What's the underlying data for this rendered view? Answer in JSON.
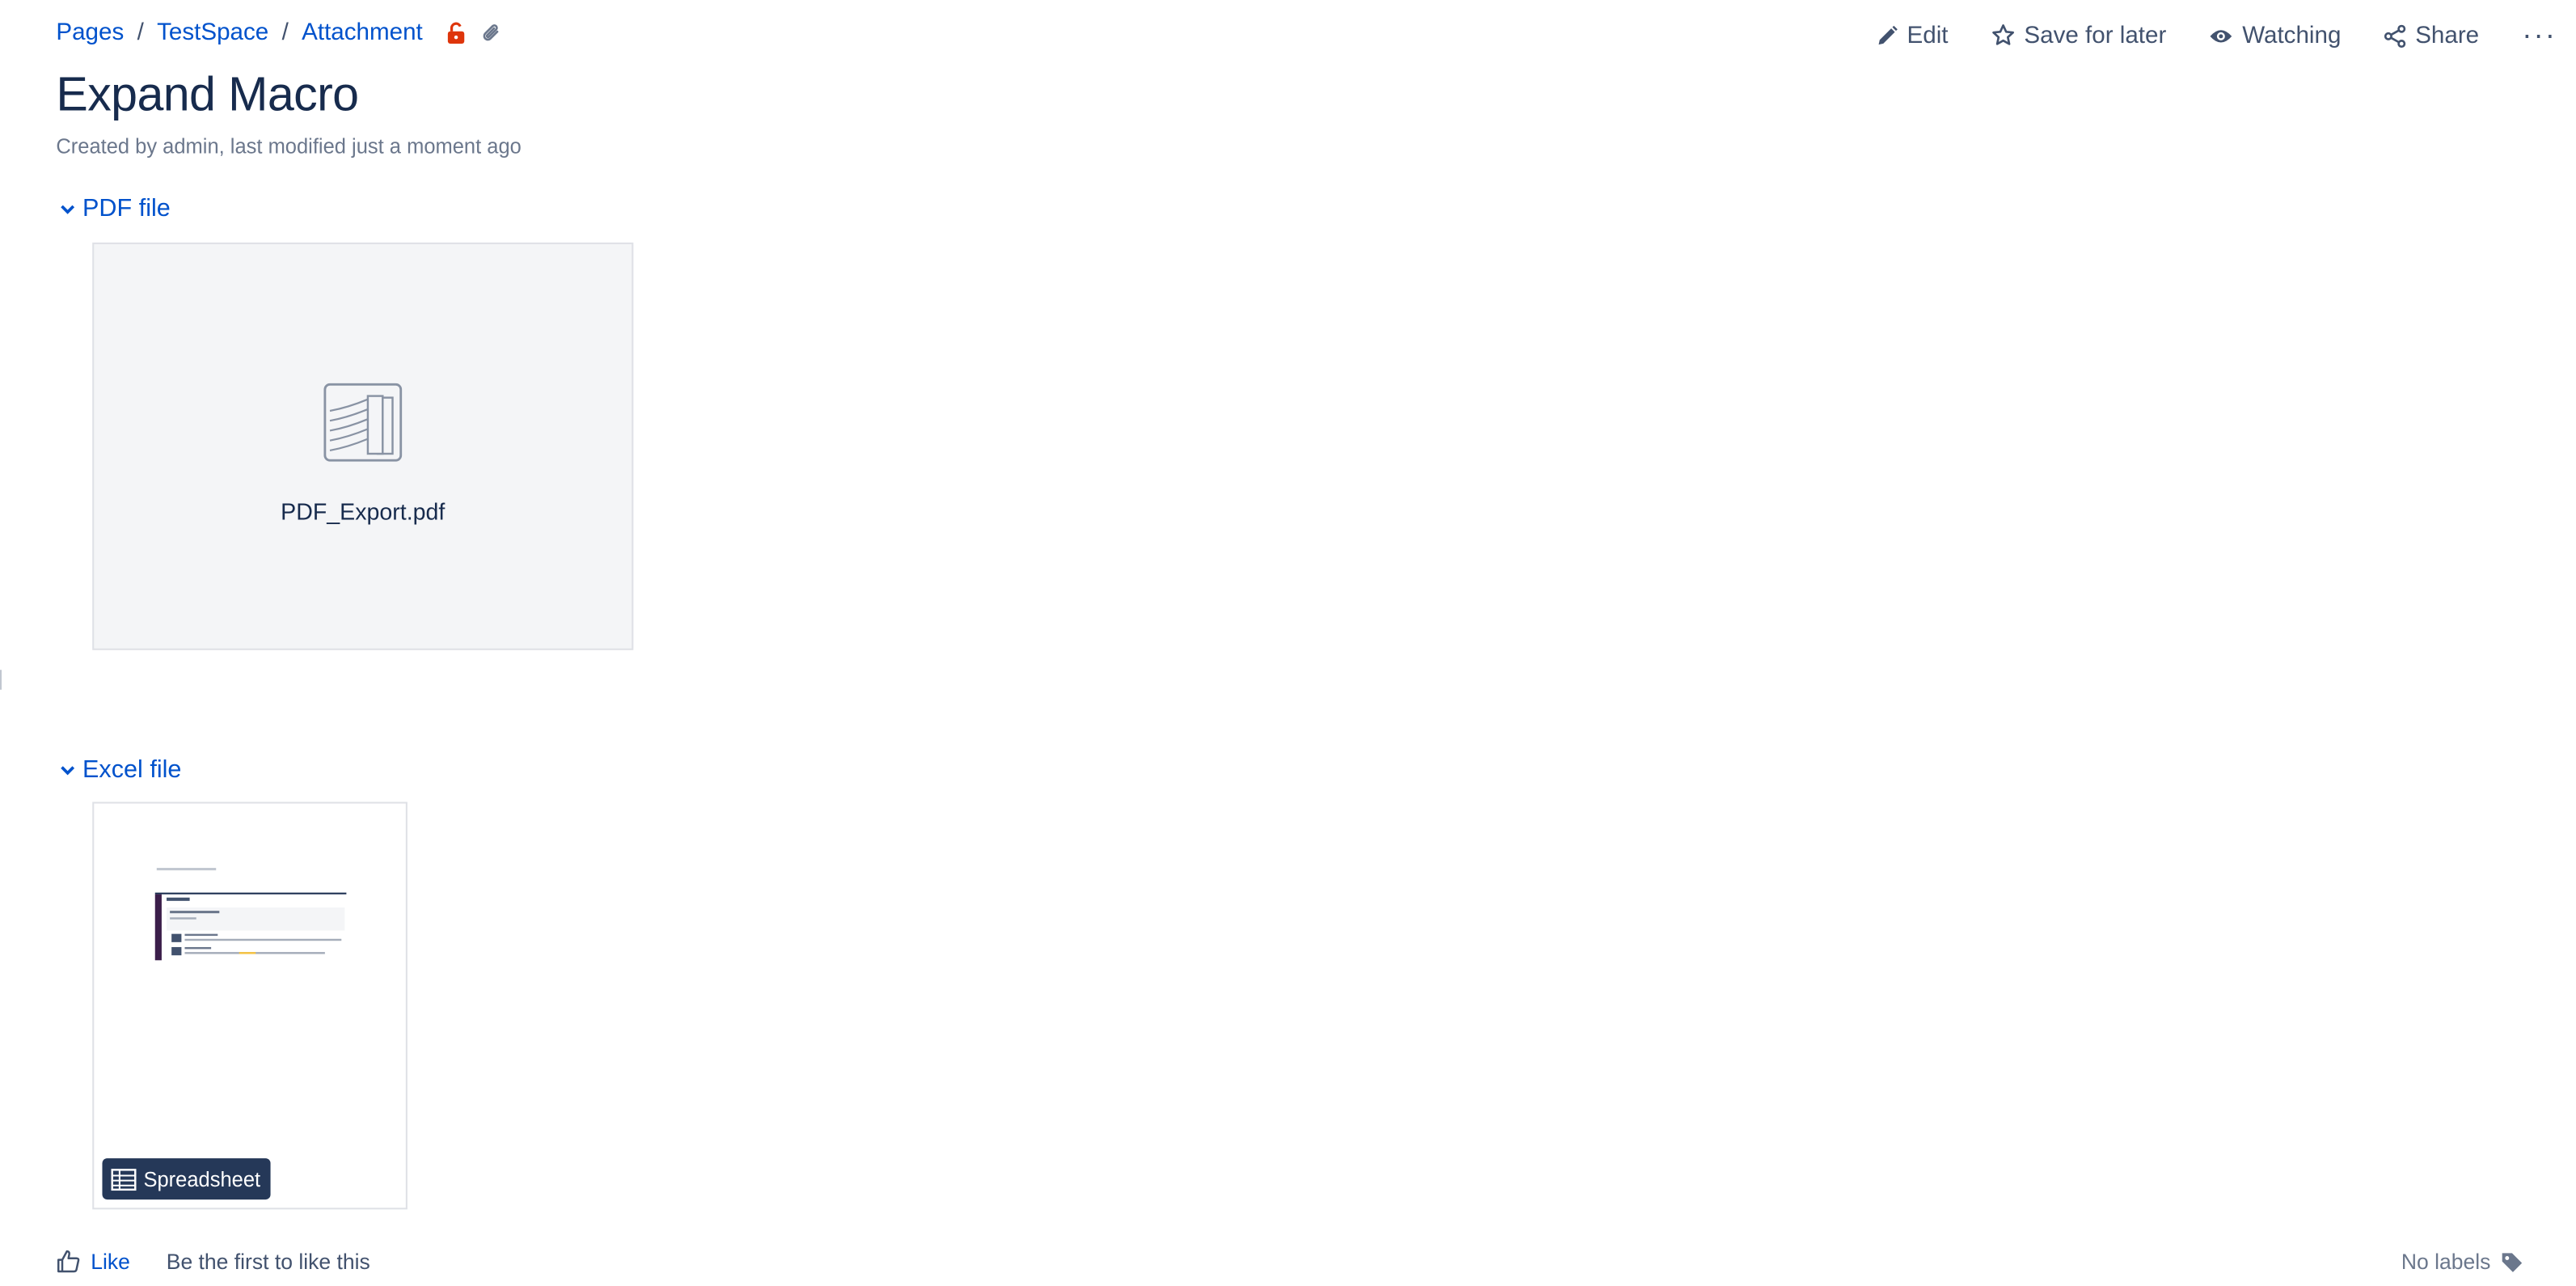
{
  "breadcrumb": {
    "items": [
      "Pages",
      "TestSpace",
      "Attachment"
    ],
    "separator": "/",
    "icons": [
      "unlocked-icon",
      "paperclip-icon"
    ]
  },
  "actions": {
    "edit": "Edit",
    "save_for_later": "Save for later",
    "watching": "Watching",
    "share": "Share",
    "more": "···"
  },
  "page": {
    "title": "Expand Macro",
    "meta": "Created by admin, last modified just a moment ago"
  },
  "expand_pdf": {
    "title": "PDF file",
    "file_name": "PDF_Export.pdf"
  },
  "expand_excel": {
    "title": "Excel file",
    "badge": "Spreadsheet"
  },
  "footer": {
    "like": "Like",
    "like_note": "Be the first to like this",
    "labels": "No labels"
  },
  "colors": {
    "link": "#0052cc",
    "text": "#172b4d",
    "muted": "#6b778c",
    "restriction": "#de350b",
    "panel": "#f4f5f7",
    "badge": "#253858"
  }
}
